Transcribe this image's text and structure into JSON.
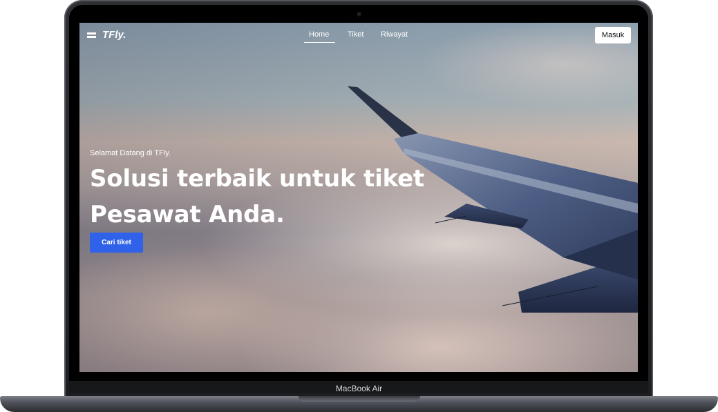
{
  "device": {
    "model_label": "MacBook Air"
  },
  "navbar": {
    "brand": "TFly.",
    "links": [
      {
        "label": "Home",
        "active": true
      },
      {
        "label": "Tiket",
        "active": false
      },
      {
        "label": "Riwayat",
        "active": false
      }
    ],
    "login_label": "Masuk"
  },
  "hero": {
    "greeting": "Selamat Datang di TFly.",
    "headline_line1": "Solusi terbaik untuk tiket",
    "headline_line2": "Pesawat Anda.",
    "cta_label": "Cari tiket"
  },
  "colors": {
    "cta": "#2f62e8",
    "nav_text": "#ffffff",
    "login_bg": "#ffffff"
  },
  "icons": {
    "logo": "ticket-icon",
    "camera": "camera-dot"
  }
}
